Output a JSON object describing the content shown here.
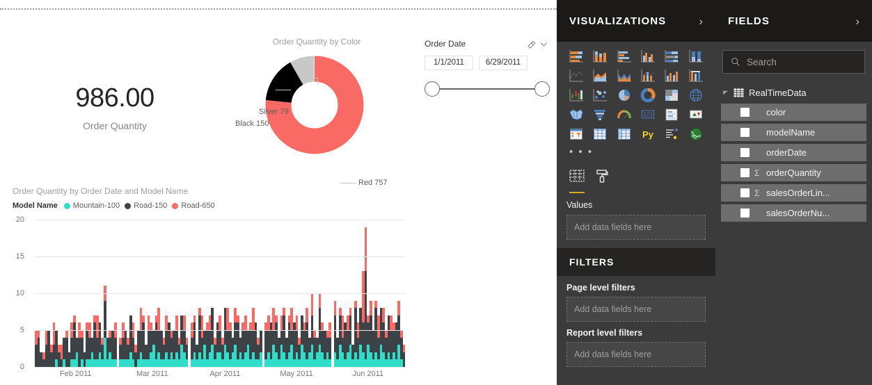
{
  "canvas": {
    "card": {
      "value": "986.00",
      "label": "Order Quantity"
    },
    "donut": {
      "title": "Order Quantity by Color",
      "labels": {
        "silver": "Silver 79",
        "black": "Black 150",
        "red": "Red 757"
      }
    },
    "slicer": {
      "title": "Order Date",
      "eraser_icon": "eraser-icon",
      "chevron_icon": "chevron-down-icon",
      "start_value": "1/1/2011",
      "end_value": "6/29/2011"
    },
    "barchart": {
      "title": "Order Quantity by Order Date and Model Name",
      "legend_title": "Model Name"
    }
  },
  "chart_data": [
    {
      "type": "pie",
      "title": "Order Quantity by Color",
      "labels": [
        "Red",
        "Black",
        "Silver"
      ],
      "values": [
        757,
        150,
        79
      ],
      "colors": [
        "#fa6a64",
        "#000000",
        "#c8c8c8"
      ],
      "donut": true,
      "legend": "labels-with-leader-lines"
    },
    {
      "type": "bar",
      "subtype": "stacked-column",
      "title": "Order Quantity by Order Date and Model Name",
      "xlabel": "",
      "ylabel": "",
      "ylim": [
        0,
        20
      ],
      "yticks": [
        0,
        5,
        10,
        15,
        20
      ],
      "grid": true,
      "legend_position": "top",
      "xticks": [
        "Feb 2011",
        "Mar 2011",
        "Apr 2011",
        "May 2011",
        "Jun 2011"
      ],
      "series": [
        {
          "name": "Mountain-100",
          "color": "#2fdec8",
          "values": [
            0,
            0,
            0,
            0,
            0,
            0,
            0,
            0,
            1,
            0,
            0,
            1,
            0,
            0,
            1,
            1,
            2,
            0,
            1,
            0,
            1,
            1,
            2,
            1,
            1,
            2,
            1,
            4,
            1,
            2,
            1,
            1,
            0,
            1,
            1,
            1,
            1,
            2,
            1,
            0,
            1,
            2,
            1,
            1,
            1,
            2,
            3,
            1,
            2,
            1,
            1,
            2,
            1,
            2,
            1,
            2,
            1,
            3,
            2,
            1,
            0,
            1,
            2,
            1,
            2,
            1,
            3,
            1,
            2,
            3,
            1,
            2,
            2,
            1,
            3,
            2,
            1,
            2,
            3,
            1,
            2,
            1,
            2,
            3,
            1,
            2,
            1,
            1,
            2,
            0,
            1,
            2,
            1,
            3,
            2,
            1,
            3,
            2,
            1,
            2,
            3,
            1,
            2,
            1,
            3,
            2,
            1,
            2,
            3,
            1,
            2,
            3,
            2,
            1,
            2,
            1,
            0,
            2,
            1,
            3,
            2,
            1,
            2,
            3,
            1,
            2,
            1,
            3,
            2,
            1,
            3,
            2,
            1,
            2,
            1,
            3,
            2,
            1,
            2,
            1,
            2,
            1,
            3,
            1,
            0
          ]
        },
        {
          "name": "Road-150",
          "color": "#3d4247",
          "values": [
            3,
            4,
            2,
            1,
            3,
            5,
            2,
            3,
            4,
            2,
            1,
            3,
            4,
            2,
            3,
            5,
            2,
            4,
            3,
            2,
            4,
            3,
            2,
            5,
            3,
            4,
            2,
            5,
            3,
            2,
            4,
            3,
            1,
            2,
            3,
            4,
            2,
            5,
            3,
            2,
            4,
            3,
            5,
            2,
            4,
            3,
            2,
            5,
            3,
            4,
            2,
            3,
            5,
            2,
            4,
            3,
            2,
            4,
            3,
            2,
            1,
            3,
            4,
            2,
            5,
            3,
            2,
            4,
            3,
            5,
            2,
            4,
            3,
            2,
            5,
            3,
            4,
            2,
            3,
            5,
            2,
            4,
            3,
            2,
            4,
            3,
            5,
            2,
            3,
            1,
            4,
            3,
            5,
            2,
            4,
            3,
            2,
            5,
            3,
            4,
            2,
            5,
            3,
            2,
            4,
            3,
            5,
            2,
            4,
            3,
            2,
            5,
            3,
            4,
            2,
            3,
            2,
            5,
            3,
            4,
            2,
            5,
            3,
            4,
            2,
            6,
            3,
            5,
            4,
            12,
            3,
            5,
            4,
            6,
            3,
            5,
            4,
            3,
            5,
            4,
            3,
            5,
            4,
            3,
            2
          ]
        },
        {
          "name": "Road-650",
          "color": "#fa6a64",
          "values": [
            2,
            1,
            0,
            1,
            2,
            0,
            1,
            3,
            0,
            1,
            2,
            0,
            1,
            0,
            2,
            1,
            0,
            2,
            1,
            0,
            1,
            2,
            0,
            1,
            3,
            0,
            1,
            2,
            0,
            1,
            0,
            2,
            0,
            1,
            2,
            0,
            1,
            0,
            2,
            1,
            0,
            3,
            1,
            0,
            2,
            1,
            0,
            1,
            3,
            0,
            1,
            2,
            0,
            1,
            0,
            2,
            1,
            0,
            2,
            1,
            0,
            2,
            1,
            0,
            1,
            3,
            0,
            1,
            2,
            0,
            1,
            0,
            2,
            1,
            0,
            3,
            1,
            0,
            2,
            1,
            0,
            1,
            2,
            0,
            1,
            3,
            0,
            1,
            0,
            0,
            1,
            2,
            0,
            3,
            1,
            0,
            2,
            1,
            0,
            1,
            3,
            0,
            2,
            1,
            0,
            1,
            2,
            0,
            3,
            1,
            0,
            2,
            1,
            0,
            1,
            2,
            1,
            2,
            0,
            1,
            3,
            0,
            2,
            1,
            0,
            1,
            2,
            0,
            7,
            6,
            1,
            2,
            0,
            1,
            3,
            0,
            2,
            1,
            0,
            2,
            1,
            0,
            2,
            1,
            1
          ]
        }
      ],
      "gap_positions": [
        32,
        60,
        89,
        116
      ]
    }
  ],
  "visualizations_pane": {
    "title": "VISUALIZATIONS",
    "collapse_icon": "chevron-right-icon",
    "icons": [
      "stacked-bar-chart-icon",
      "stacked-column-chart-icon",
      "clustered-bar-chart-icon",
      "clustered-column-chart-icon",
      "100-percent-stacked-bar-chart-icon",
      "100-percent-stacked-column-chart-icon",
      "line-chart-icon",
      "area-chart-icon",
      "stacked-area-chart-icon",
      "line-and-stacked-column-chart-icon",
      "line-and-clustered-column-chart-icon",
      "ribbon-chart-icon",
      "waterfall-chart-icon",
      "scatter-chart-icon",
      "pie-chart-icon",
      "donut-chart-icon",
      "treemap-icon",
      "map-icon",
      "filled-map-icon",
      "funnel-chart-icon",
      "gauge-chart-icon",
      "card-icon",
      "multi-row-card-icon",
      "kpi-icon",
      "slicer-icon",
      "table-icon",
      "matrix-icon",
      "python-visual-icon",
      "r-script-visual-icon",
      "arcgis-map-icon"
    ],
    "more_icon": "ellipsis-icon",
    "tabs": [
      {
        "name": "fields-tab",
        "icon": "fields-pane-icon",
        "active": true
      },
      {
        "name": "format-tab",
        "icon": "paint-roller-icon",
        "active": false
      }
    ],
    "values_well": {
      "title": "Values",
      "placeholder": "Add data fields here"
    },
    "filters": {
      "title": "FILTERS",
      "page_level_label": "Page level filters",
      "page_level_placeholder": "Add data fields here",
      "report_level_label": "Report level filters",
      "report_level_placeholder": "Add data fields here"
    }
  },
  "fields_pane": {
    "title": "FIELDS",
    "collapse_icon": "chevron-right-icon",
    "search": {
      "icon": "search-icon",
      "placeholder": "Search",
      "value": ""
    },
    "table": {
      "name": "RealTimeData",
      "icon": "table-icon",
      "expand_icon": "triangle-collapse-icon"
    },
    "fields": [
      {
        "name": "color",
        "aggregate": false
      },
      {
        "name": "modelName",
        "aggregate": false
      },
      {
        "name": "orderDate",
        "aggregate": false
      },
      {
        "name": "orderQuantity",
        "aggregate": true
      },
      {
        "name": "salesOrderLin...",
        "aggregate": true
      },
      {
        "name": "salesOrderNu...",
        "aggregate": false
      }
    ],
    "sigma_glyph": "Σ"
  },
  "colors": {
    "accent_red": "#fa6a64",
    "teal": "#2fdec8",
    "dark_slate": "#3d4247",
    "black": "#000000",
    "silver": "#c8c8c8",
    "pane_bg": "#3b3b3b",
    "pane_header_bg": "#1b1a19",
    "gold_underline": "#d9a91a"
  }
}
